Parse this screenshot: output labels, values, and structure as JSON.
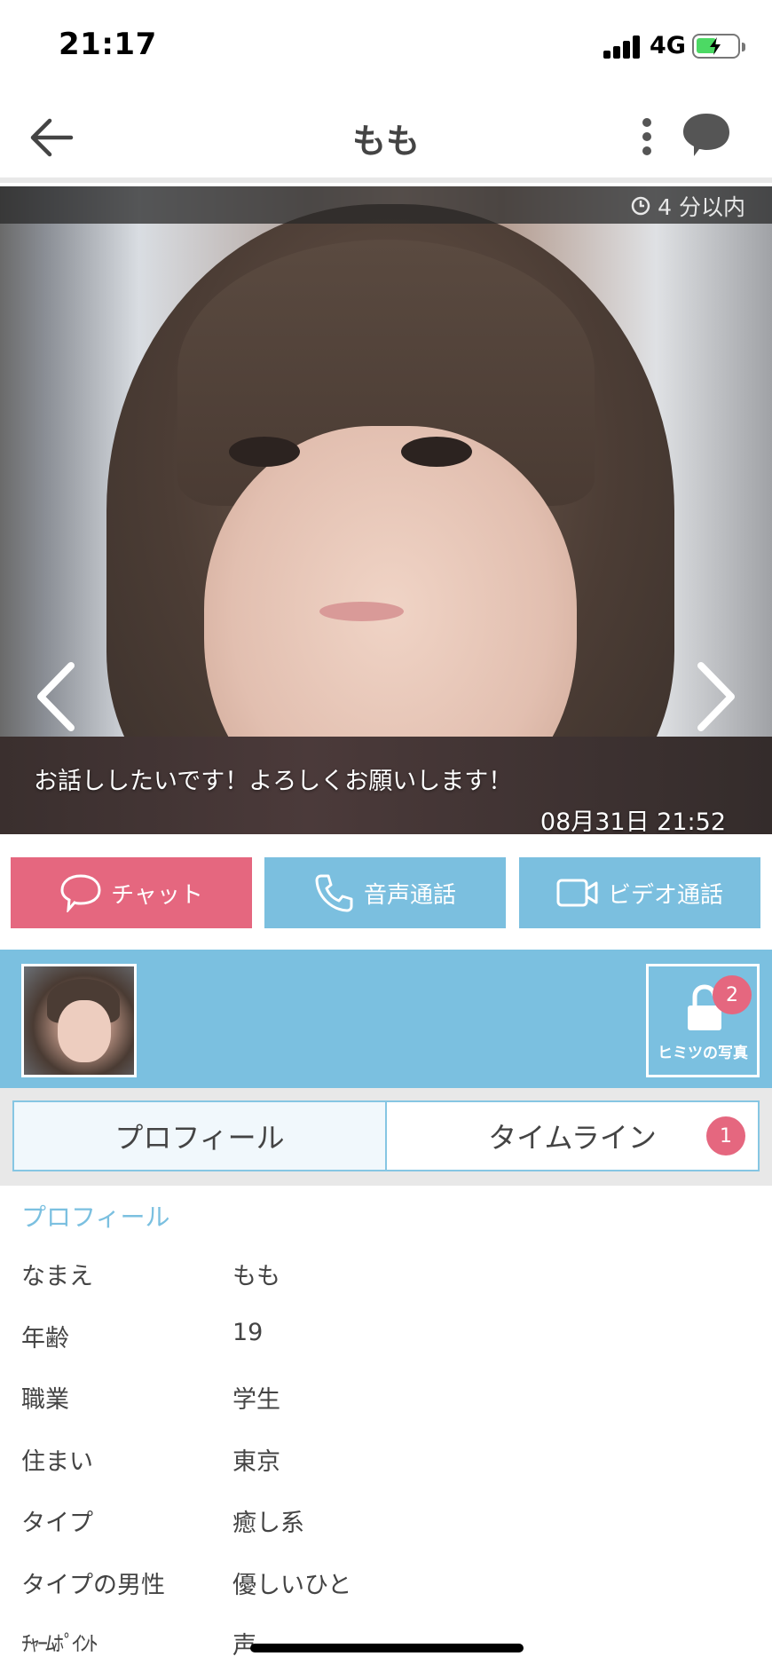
{
  "status_bar": {
    "time": "21:17",
    "network": "4G"
  },
  "header": {
    "title": "もも"
  },
  "photo": {
    "last_login": "4 分以内",
    "message": "お話ししたいです！よろしくお願いします！",
    "date": "08月31日 21:52"
  },
  "actions": {
    "chat": "チャット",
    "voice": "音声通話",
    "video": "ビデオ通話"
  },
  "secret_photos": {
    "label": "ヒミツの写真",
    "count": "2"
  },
  "tabs": {
    "profile": "プロフィール",
    "timeline": "タイムライン",
    "timeline_badge": "1"
  },
  "profile": {
    "section_title": "プロフィール",
    "rows": [
      {
        "label": "なまえ",
        "value": "もも"
      },
      {
        "label": "年齢",
        "value": "19"
      },
      {
        "label": "職業",
        "value": "学生"
      },
      {
        "label": "住まい",
        "value": "東京"
      },
      {
        "label": "タイプ",
        "value": "癒し系"
      },
      {
        "label": "タイプの男性",
        "value": "優しいひと"
      },
      {
        "label": "ﾁｬｰﾑﾎﾟｲﾝﾄ",
        "value": "声"
      }
    ]
  },
  "colors": {
    "accent_pink": "#e5677f",
    "accent_blue": "#7bc0e0"
  }
}
